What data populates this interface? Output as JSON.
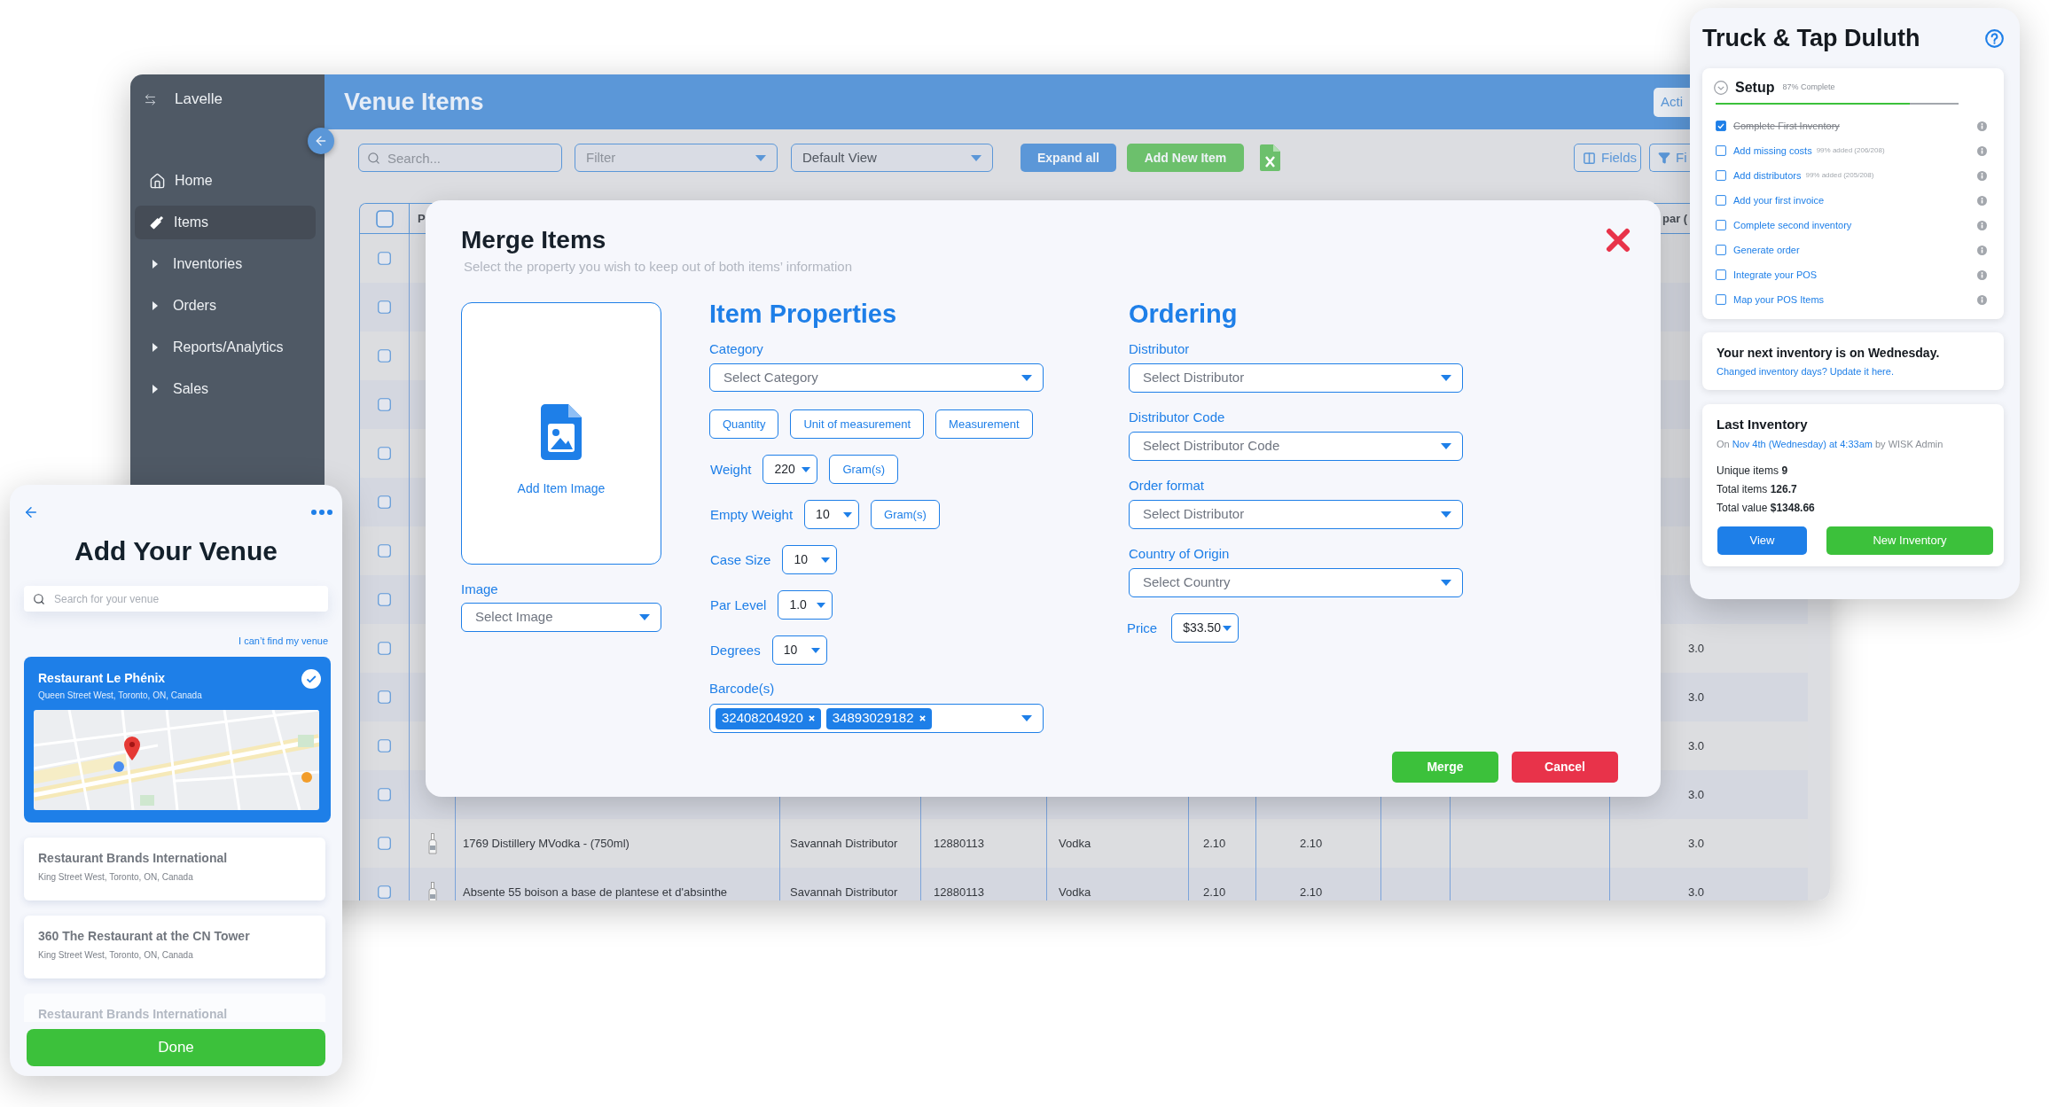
{
  "app_window": {
    "sidebar": {
      "venue_name": "Lavelle",
      "items": [
        {
          "label": "Home",
          "kind": "link",
          "selected": false
        },
        {
          "label": "Items",
          "kind": "link",
          "selected": true
        },
        {
          "label": "Inventories",
          "kind": "group",
          "selected": false,
          "expanded": false
        },
        {
          "label": "Orders",
          "kind": "group",
          "selected": false,
          "expanded": false
        },
        {
          "label": "Reports/Analytics",
          "kind": "group",
          "selected": false,
          "expanded": false
        },
        {
          "label": "Sales",
          "kind": "group",
          "selected": false,
          "expanded": false
        }
      ]
    },
    "header": {
      "title": "Venue Items",
      "action_button": "Acti"
    },
    "toolbar": {
      "search": {
        "placeholder": "Search..."
      },
      "filter": {
        "placeholder": "Filter"
      },
      "view_select": {
        "value": "Default View"
      },
      "buttons": [
        {
          "label": "Expand all",
          "kind": "primary"
        },
        {
          "label": "Add New Item",
          "kind": "success"
        }
      ],
      "right_buttons": [
        {
          "label": "Fields",
          "kind": "fields"
        },
        {
          "label": "Fi",
          "kind": "filter"
        }
      ]
    },
    "table": {
      "header_checked": false,
      "columns": {
        "column_2": "P",
        "column_11": "par ("
      },
      "rows": [
        {
          "checked": false
        },
        {
          "checked": false
        },
        {
          "checked": false
        },
        {
          "checked": false
        },
        {
          "checked": false
        },
        {
          "checked": false
        },
        {
          "checked": false
        },
        {
          "checked": false
        },
        {
          "checked": false,
          "column_11": "3.0"
        },
        {
          "checked": false,
          "column_11": "3.0"
        },
        {
          "checked": false,
          "column_11": "3.0"
        },
        {
          "checked": false,
          "column_11": "3.0"
        },
        {
          "checked": false,
          "column_3": "1769 Distillery MVodka - (750ml)",
          "column_4": "Savannah Distributor",
          "column_5": "12880113",
          "column_6": "Vodka",
          "column_7": "2.10",
          "column_8": "2.10",
          "column_11": "3.0"
        },
        {
          "checked": false,
          "column_3": "Absente 55 boison a base de plantese et d'absinthe",
          "column_4": "Savannah Distributor",
          "column_5": "12880113",
          "column_6": "Vodka",
          "column_7": "2.10",
          "column_8": "2.10",
          "column_11": "3.0"
        }
      ]
    }
  },
  "merge_modal": {
    "title": "Merge Items",
    "subtitle": "Select the property you wish to keep out of both items’ information",
    "image": {
      "add_label": "Add Item Image",
      "label": "Image",
      "placeholder": "Select Image"
    },
    "item_properties": {
      "heading": "Item Properties",
      "category": {
        "label": "Category",
        "placeholder": "Select Category"
      },
      "unit_options": [
        "Quantity",
        "Unit of measurement",
        "Measurement"
      ],
      "fields": [
        {
          "label": "Weight",
          "value": "220",
          "unit": "Gram(s)"
        },
        {
          "label": "Empty Weight",
          "value": "10",
          "unit": "Gram(s)"
        },
        {
          "label": "Case Size",
          "value": "10"
        },
        {
          "label": "Par Level",
          "value": "1.0"
        },
        {
          "label": "Degrees",
          "value": "10"
        }
      ],
      "barcodes": {
        "label": "Barcode(s)",
        "values": [
          "32408204920",
          "34893029182"
        ]
      }
    },
    "ordering": {
      "heading": "Ordering",
      "selects": [
        {
          "label": "Distributor",
          "placeholder": "Select Distributor"
        },
        {
          "label": "Distributor Code",
          "placeholder": "Select Distributor Code"
        },
        {
          "label": "Order format",
          "placeholder": "Select Distributor"
        },
        {
          "label": "Country of Origin",
          "placeholder": "Select Country"
        }
      ],
      "price": {
        "label": "Price",
        "value": "$33.50"
      }
    },
    "buttons": [
      {
        "label": "Merge",
        "kind": "confirm"
      },
      {
        "label": "Cancel",
        "kind": "cancel"
      }
    ]
  },
  "setup_panel": {
    "title": "Truck & Tap Duluth",
    "setup": {
      "title": "Setup",
      "progress_text": "87% Complete",
      "level": 0.8,
      "tasks": [
        {
          "label": "Complete First Inventory",
          "checked": true
        },
        {
          "label": "Add missing costs",
          "note": "99% added (206/208)",
          "checked": false
        },
        {
          "label": "Add distributors",
          "note": "99% added (205/208)",
          "checked": false
        },
        {
          "label": "Add your first invoice",
          "checked": false
        },
        {
          "label": "Complete second inventory",
          "checked": false
        },
        {
          "label": "Generate order",
          "checked": false
        },
        {
          "label": "Integrate your POS",
          "checked": false
        },
        {
          "label": "Map your POS Items",
          "checked": false
        }
      ]
    },
    "next_inventory": {
      "text": "Your next inventory is on Wednesday.",
      "link": "Changed inventory days? Update it here."
    },
    "last_inventory": {
      "title": "Last Inventory",
      "prefix": "On",
      "date_link": "Nov 4th (Wednesday) at 4:33am",
      "suffix": "by WISK Admin",
      "stats": [
        "Unique items **9**",
        "Total items **126.7**",
        "Total value **$1348.66**"
      ],
      "buttons": [
        {
          "label": "View",
          "kind": "primary"
        },
        {
          "label": "New Inventory",
          "kind": "success"
        }
      ]
    }
  },
  "venue_panel": {
    "title": "Add Your Venue",
    "search": {
      "placeholder": "Search for your venue"
    },
    "missing_link": "I can’t find my venue",
    "venues": [
      {
        "name": "Restaurant Le Phénix",
        "address": "Queen Street West, Toronto, ON, Canada",
        "selected": true
      },
      {
        "name": "Restaurant Brands International",
        "address": "King Street West, Toronto, ON, Canada",
        "selected": false
      },
      {
        "name": "360 The Restaurant at the CN Tower",
        "address": "King Street West, Toronto, ON, Canada",
        "selected": false
      }
    ],
    "faded_venue": "Restaurant Brands International",
    "done_button": "Done"
  }
}
